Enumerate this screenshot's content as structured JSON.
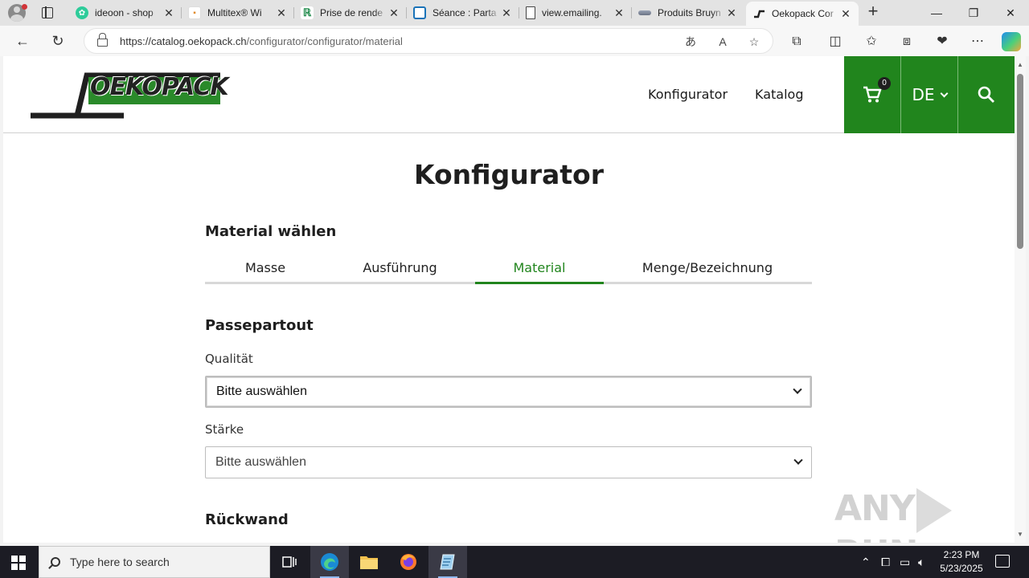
{
  "browser": {
    "tabs": [
      {
        "title": "ideoon - shop",
        "active": false
      },
      {
        "title": "Multitex® Wi",
        "active": false
      },
      {
        "title": "Prise de rende",
        "active": false
      },
      {
        "title": "Séance : Parta",
        "active": false
      },
      {
        "title": "view.emailing.",
        "active": false
      },
      {
        "title": "Produits Bruyn",
        "active": false
      },
      {
        "title": "Oekopack Cor",
        "active": true
      }
    ],
    "url_host": "https://catalog.oekopack.ch",
    "url_path": "/configurator/configurator/material",
    "accent": "#21851d"
  },
  "site": {
    "logo_text": "OEKOPACK",
    "nav": {
      "configurator": "Konfigurator",
      "catalog": "Katalog"
    },
    "cart_count": "0",
    "language": "DE"
  },
  "page": {
    "title": "Konfigurator",
    "step_heading": "Material wählen",
    "steps": [
      "Masse",
      "Ausführung",
      "Material",
      "Menge/Bezeichnung"
    ],
    "active_step": "Material",
    "passepartout": {
      "heading": "Passepartout",
      "quality_label": "Qualität",
      "quality_value": "Bitte auswählen",
      "thickness_label": "Stärke",
      "thickness_value": "Bitte auswählen"
    },
    "backwall_heading": "Rückwand"
  },
  "watermark": {
    "left": "ANY",
    "right": "RUN"
  },
  "taskbar": {
    "search_placeholder": "Type here to search",
    "time": "2:23 PM",
    "date": "5/23/2025"
  }
}
